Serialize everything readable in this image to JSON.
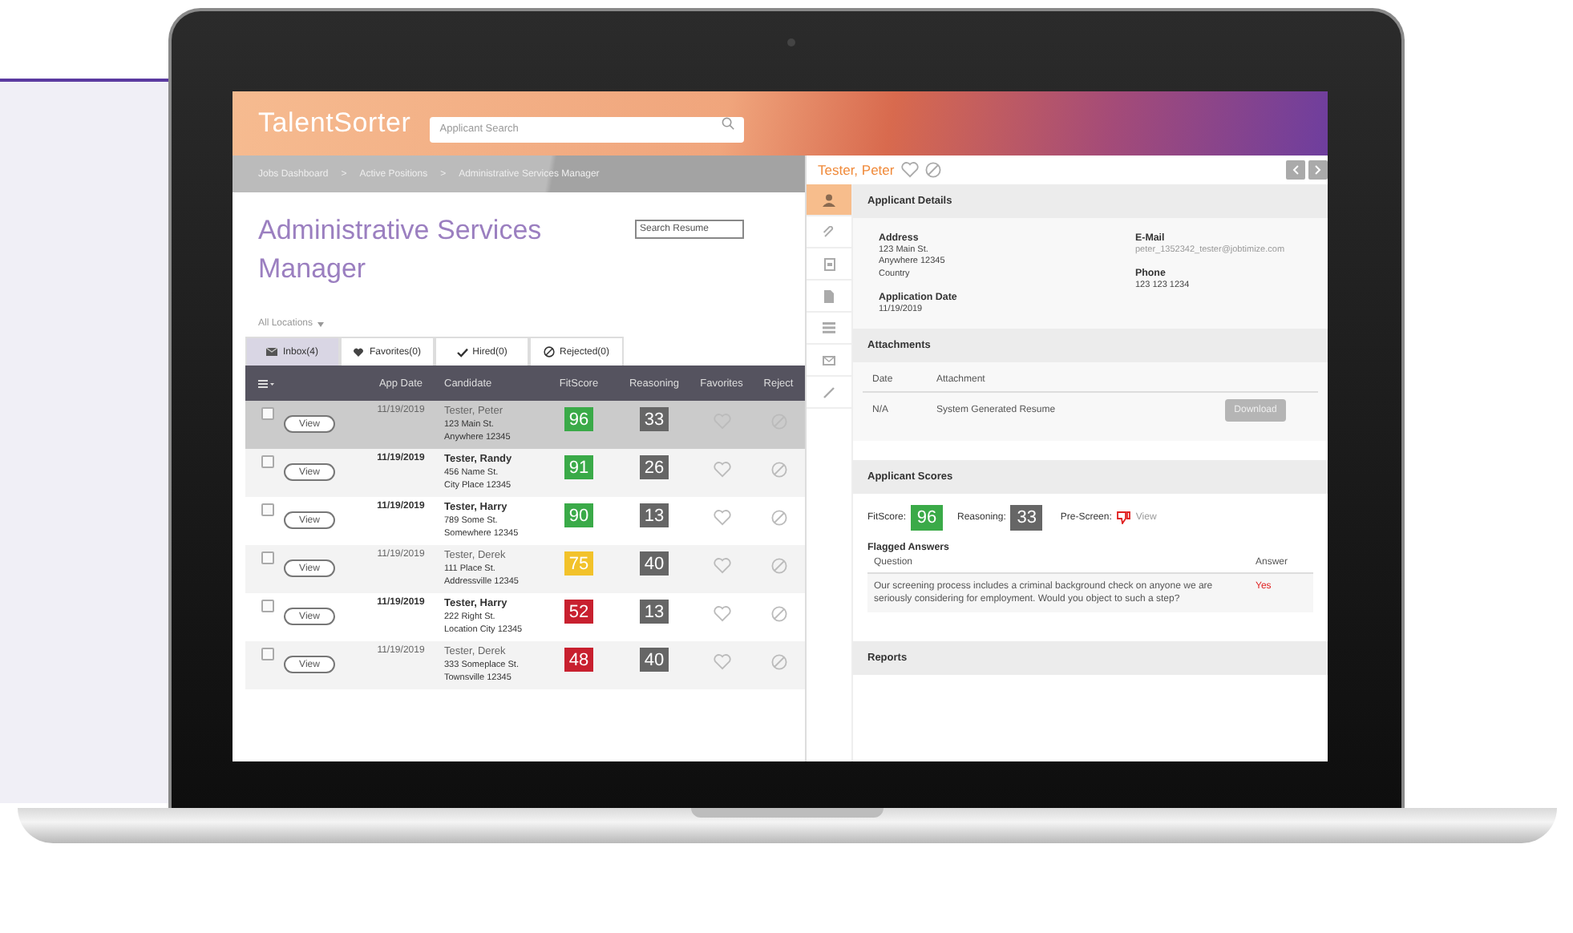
{
  "header": {
    "logo": "TalentSorter",
    "search_placeholder": "Applicant Search"
  },
  "breadcrumb": [
    "Jobs Dashboard",
    ">",
    "Active Positions",
    ">",
    "Administrative Services Manager"
  ],
  "job": {
    "title": "Administrative Services Manager",
    "location_filter": "All Locations",
    "resume_search_placeholder": "Search Resume"
  },
  "tabs": [
    {
      "label": "Inbox(4)",
      "selected": true
    },
    {
      "label": "Favorites(0)",
      "selected": false
    },
    {
      "label": "Hired(0)",
      "selected": false
    },
    {
      "label": "Rejected(0)",
      "selected": false
    }
  ],
  "table": {
    "columns": [
      "App Date",
      "Candidate",
      "FitScore",
      "Reasoning",
      "Favorites",
      "Reject"
    ],
    "rows": [
      {
        "checked": false,
        "selected": true,
        "unread": false,
        "view": "View",
        "date": "11/19/2019",
        "name": "Tester, Peter",
        "street": "123 Main St.",
        "city": "Anywhere 12345",
        "fit": {
          "value": "96",
          "color": "#3aaa48"
        },
        "reasoning": "33"
      },
      {
        "checked": false,
        "selected": false,
        "unread": true,
        "view": "View",
        "date": "11/19/2019",
        "name": "Tester, Randy",
        "street": "456 Name St.",
        "city": "City Place 12345",
        "fit": {
          "value": "91",
          "color": "#3aaa48"
        },
        "reasoning": "26"
      },
      {
        "checked": false,
        "selected": false,
        "unread": true,
        "view": "View",
        "date": "11/19/2019",
        "name": "Tester, Harry",
        "street": "789 Some St.",
        "city": "Somewhere 12345",
        "fit": {
          "value": "90",
          "color": "#3aaa48"
        },
        "reasoning": "13"
      },
      {
        "checked": false,
        "selected": false,
        "unread": false,
        "view": "View",
        "date": "11/19/2019",
        "name": "Tester, Derek",
        "street": "111 Place St.",
        "city": "Addressville 12345",
        "fit": {
          "value": "75",
          "color": "#f2c22a"
        },
        "reasoning": "40"
      },
      {
        "checked": false,
        "selected": false,
        "unread": true,
        "view": "View",
        "date": "11/19/2019",
        "name": "Tester, Harry",
        "street": "222 Right St.",
        "city": "Location City 12345",
        "fit": {
          "value": "52",
          "color": "#c8202f"
        },
        "reasoning": "13"
      },
      {
        "checked": false,
        "selected": false,
        "unread": false,
        "view": "View",
        "date": "11/19/2019",
        "name": "Tester, Derek",
        "street": "333 Someplace St.",
        "city": "Townsville 12345",
        "fit": {
          "value": "48",
          "color": "#c8202f"
        },
        "reasoning": "40"
      }
    ]
  },
  "detail": {
    "name": "Tester, Peter",
    "tabs": [
      {
        "selected": true
      },
      {
        "selected": false
      },
      {
        "selected": false
      },
      {
        "selected": false
      },
      {
        "selected": false
      },
      {
        "selected": false
      },
      {
        "selected": false
      }
    ],
    "applicant_details": {
      "title": "Applicant Details",
      "address_label": "Address",
      "address_lines": [
        "123 Main St.",
        "Anywhere 12345",
        "Country"
      ],
      "date_label": "Application Date",
      "date": "11/19/2019",
      "email_label": "E-Mail",
      "email": "peter_1352342_tester@jobtimize.com",
      "phone_label": "Phone",
      "phone": "123 123 1234"
    },
    "attachments": {
      "title": "Attachments",
      "columns": [
        "Date",
        "Attachment"
      ],
      "rows": [
        {
          "date": "N/A",
          "attachment": "System Generated Resume",
          "action": "Download",
          "disabled": true
        }
      ]
    },
    "scores": {
      "title": "Applicant Scores",
      "fit_label": "FitScore:",
      "fit": {
        "value": "96",
        "color": "#3aaa48"
      },
      "reasoning_label": "Reasoning:",
      "reasoning": "33",
      "prescreen_label": "Pre-Screen:",
      "prescreen_link": "View",
      "flagged_title": "Flagged Answers",
      "columns": [
        "Question",
        "Answer"
      ],
      "rows": [
        {
          "question": "Our screening process includes a criminal background check on anyone we are seriously considering for employment. Would you object to such a step?",
          "answer": "Yes"
        }
      ]
    },
    "reports": {
      "title": "Reports"
    }
  }
}
